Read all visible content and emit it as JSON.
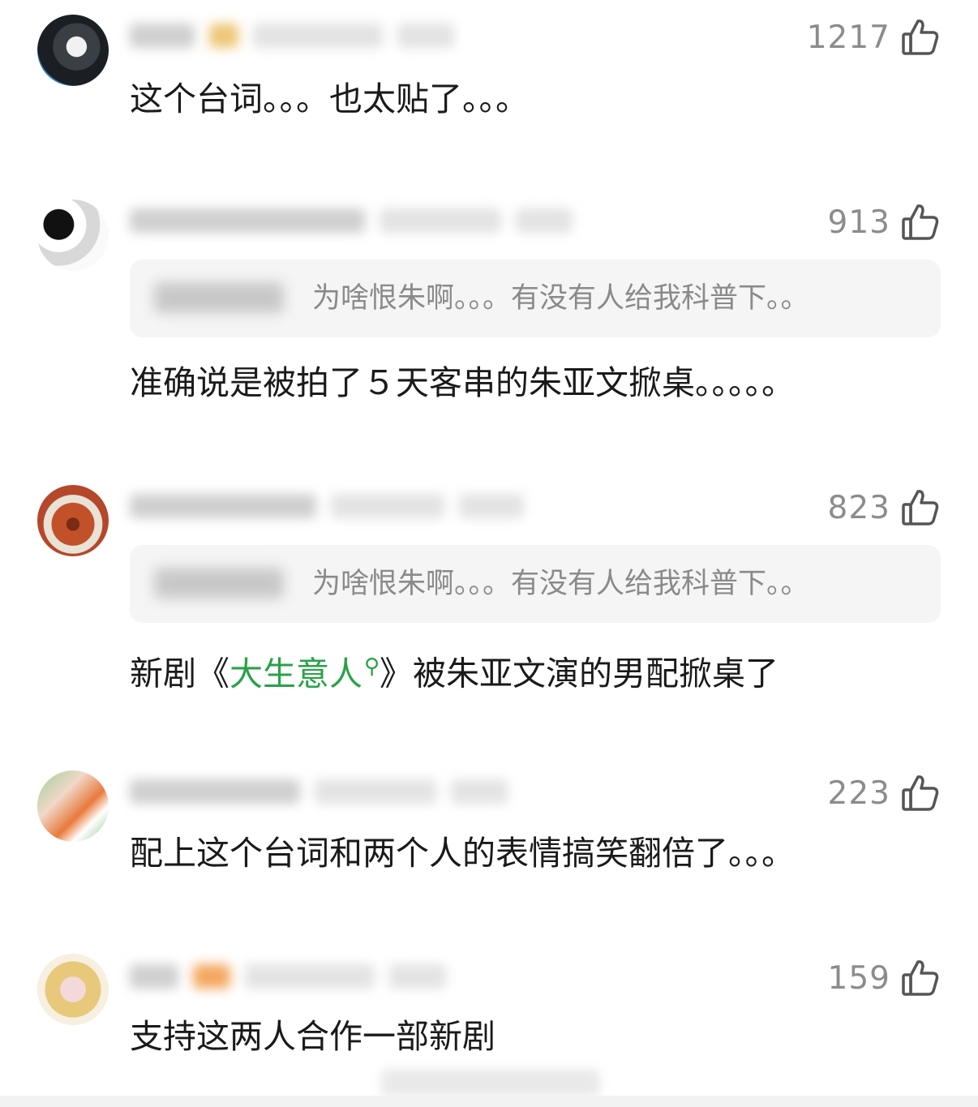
{
  "comments": [
    {
      "likes": "1217",
      "text": "这个台词。。。也太贴了。。。"
    },
    {
      "likes": "913",
      "quote": "为啥恨朱啊。。。有没有人给我科普下。。",
      "text": "准确说是被拍了５天客串的朱亚文掀桌。。。。。"
    },
    {
      "likes": "823",
      "quote": "为啥恨朱啊。。。有没有人给我科普下。。",
      "text_before": "新剧《",
      "link": "大生意人",
      "text_after": "》被朱亚文演的男配掀桌了"
    },
    {
      "likes": "223",
      "text": "配上这个台词和两个人的表情搞笑翻倍了。。。"
    },
    {
      "likes": "159",
      "text": "支持这两人合作一部新剧"
    }
  ],
  "icons": {
    "like": "thumbs-up-icon",
    "search": "search-icon"
  },
  "colors": {
    "link": "#2aa148",
    "likes": "#8c8c8c",
    "quote_bg": "#f5f5f5"
  }
}
